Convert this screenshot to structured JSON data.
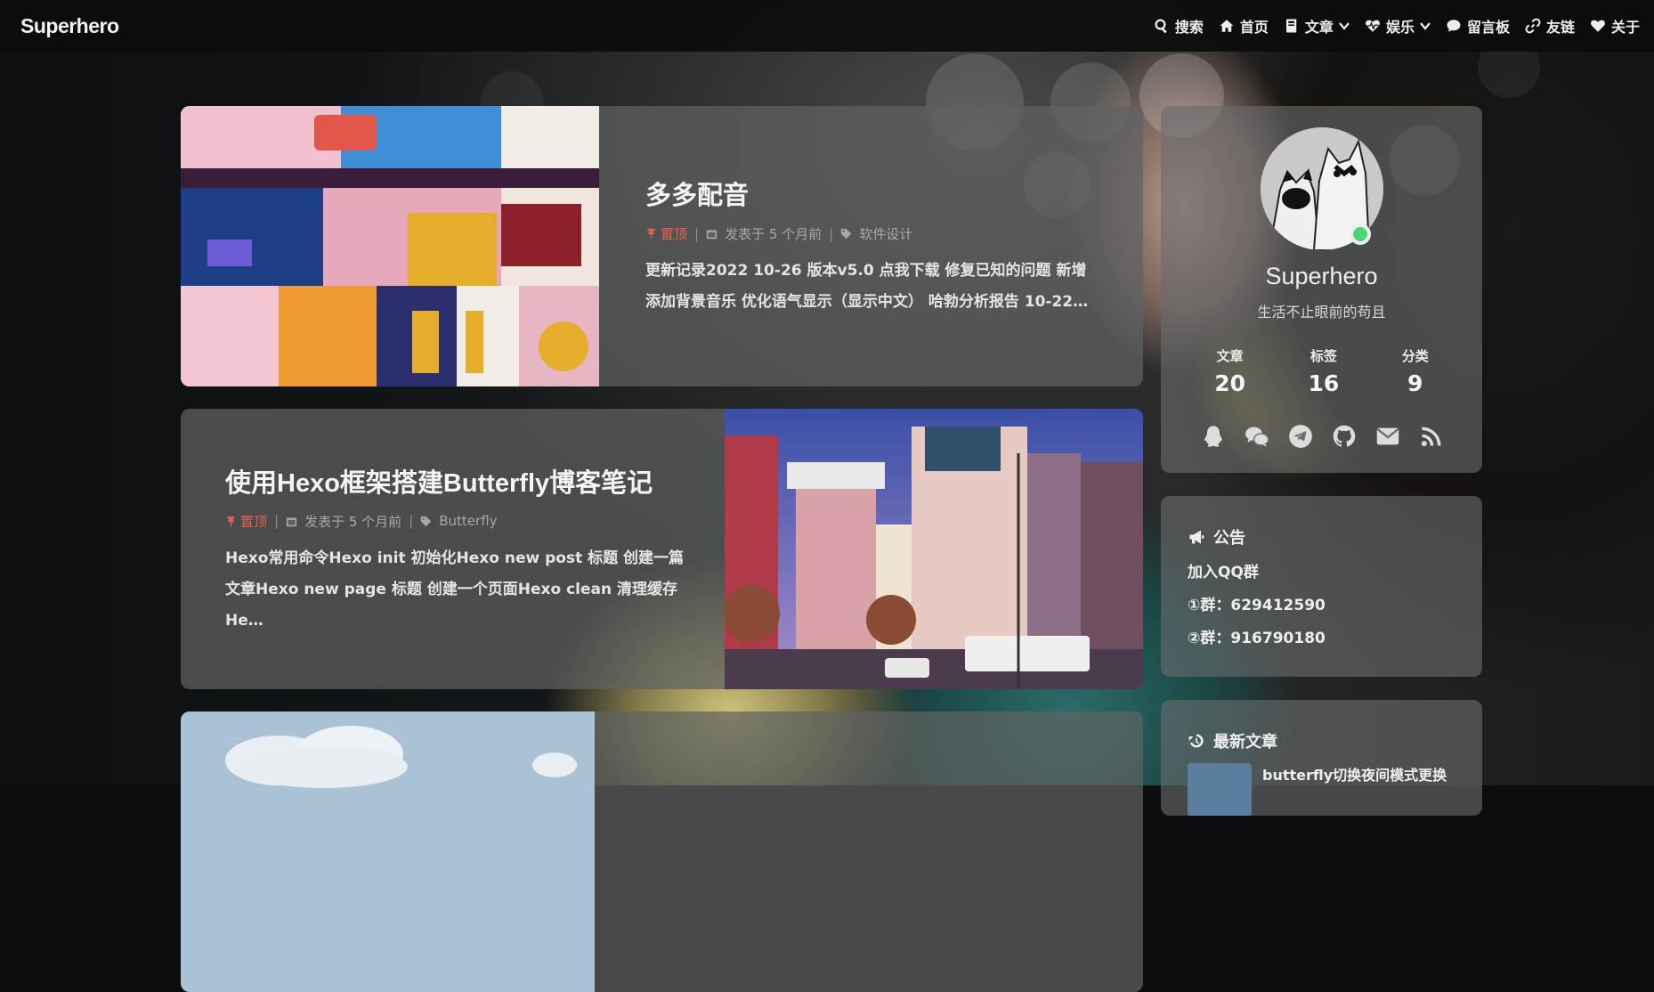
{
  "site": {
    "brand": "Superhero"
  },
  "nav": {
    "items": [
      {
        "label": "搜索",
        "icon": "search-icon"
      },
      {
        "label": "首页",
        "icon": "home-icon"
      },
      {
        "label": "文章",
        "icon": "book-icon",
        "dropdown": true
      },
      {
        "label": "娱乐",
        "icon": "heartbeat-icon",
        "dropdown": true
      },
      {
        "label": "留言板",
        "icon": "comment-icon"
      },
      {
        "label": "友链",
        "icon": "link-icon"
      },
      {
        "label": "关于",
        "icon": "heart-icon"
      }
    ]
  },
  "posts": [
    {
      "title": "多多配音",
      "pinned": "置顶",
      "date": "发表于 5 个月前",
      "tag": "软件设计",
      "excerpt": "更新记录2022 10-26 版本v5.0 点我下载 修复已知的问题 新增添加背景音乐 优化语气显示（显示中文） 哈勃分析报告 10-22…"
    },
    {
      "title": "使用Hexo框架搭建Butterfly博客笔记",
      "pinned": "置顶",
      "date": "发表于 5 个月前",
      "tag": "Butterfly",
      "excerpt": "Hexo常用命令Hexo init 初始化Hexo new post 标题 创建一篇文章Hexo new page 标题 创建一个页面Hexo clean 清理缓存He…"
    }
  ],
  "author": {
    "name": "Superhero",
    "description": "生活不止眼前的苟且",
    "stats": [
      {
        "label": "文章",
        "value": "20"
      },
      {
        "label": "标签",
        "value": "16"
      },
      {
        "label": "分类",
        "value": "9"
      }
    ],
    "socials": [
      "qq-icon",
      "wechat-icon",
      "telegram-icon",
      "github-icon",
      "email-icon",
      "rss-icon"
    ]
  },
  "announcement": {
    "heading": "公告",
    "lines": [
      "加入QQ群",
      "①群：629412590",
      "②群：916790180"
    ]
  },
  "recent": {
    "heading": "最新文章",
    "first_title": "butterfly切换夜间模式更换"
  },
  "colors": {
    "pin": "#e3614f",
    "online": "#4ad675"
  }
}
